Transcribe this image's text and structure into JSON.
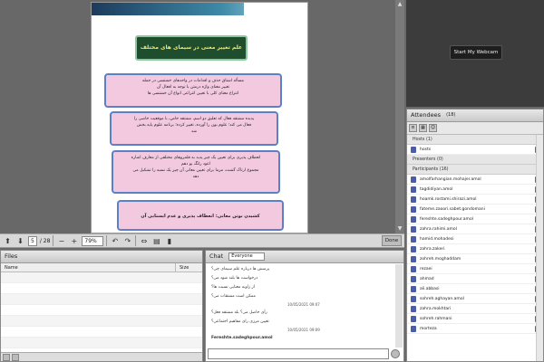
{
  "slide": {
    "title": "علم تغییر معنی در سیمای های مختلف",
    "box1": [
      "مسأله اشتاق حذف و اقدامات در واحدهای خشتسی در جمله",
      "تغییر معنای واژه درمتن با توجه به افعال آن",
      "انتزاع معنای کلی با تعیین انتزاعی انواع آن خشتسی ها"
    ],
    "box2": [
      "پدیده مشتقه فعال که تعلیق دو اسم، مشتقه خاص، با موقعیت خاصی را",
      "فعال می کند؛ علوم بون را آورده، تغییر کرده؛ برنامه علوم پایه بخش",
      "شد"
    ],
    "box3": [
      "انعطاف پذیری برای تعیین یک چیز پدید به قلمروهای مختلفی از معارف اشاره",
      "اعود رانگ یو دهم",
      "مجموع ارتاک گشت، مزما برای تعیین معانی آن چیز یک نسبه را تشکیل می",
      "دهد"
    ],
    "box4": "کشیدن بوتن معانی: انعطاف پذیری و عدم ایستایی آن"
  },
  "toolbar": {
    "page_current": "5",
    "page_total": "/ 28",
    "zoom": "79%",
    "done_label": "Done"
  },
  "files": {
    "title": "Files",
    "col_name": "Name",
    "col_size": "Size"
  },
  "chat": {
    "title": "Chat",
    "selector": "Everyone",
    "messages": [
      "پرسش ها درباره علم سیمای چی؟",
      "درخواست ها بلند شود می؟",
      "از زاویه معنایی نسبت ها؟",
      "ممکن است مشتقات می؟",
      "رأی حاصل می؟ بله مشتقه فعل؟",
      "تعیین مرزی رای مفاهیم اجتماعی؟"
    ],
    "timestamps": [
      "10/05/2021 09:07",
      "10/05/2021 09:09"
    ],
    "sender": "Fereshte.sadeghpour.amol"
  },
  "webcam": {
    "button_label": "Start My Webcam"
  },
  "attendees": {
    "title": "Attendees",
    "count": "(18)",
    "group_hosts": "Hosts (1)",
    "host_name": "hosts",
    "group_presenters": "Presenters (0)",
    "group_participants": "Participants (16)",
    "participants": [
      "amolfarhangian.mohajer.amol",
      "tagdidiyan.amol",
      "hoamk.rostami.shirazi.amol",
      "fateme.zaoori.sabet.gondomani",
      "fereshte.sadeghpour.amol",
      "zahra.rahimi.amol",
      "hamid.mohadesi",
      "zahra.zakeri",
      "zohreh.moghaddam",
      "rezaei",
      "ahmad",
      "ali.abbasi",
      "sohreh.aghayan.amol",
      "zahra.mokhtari",
      "sohreh.rahmani",
      "morteza"
    ]
  }
}
